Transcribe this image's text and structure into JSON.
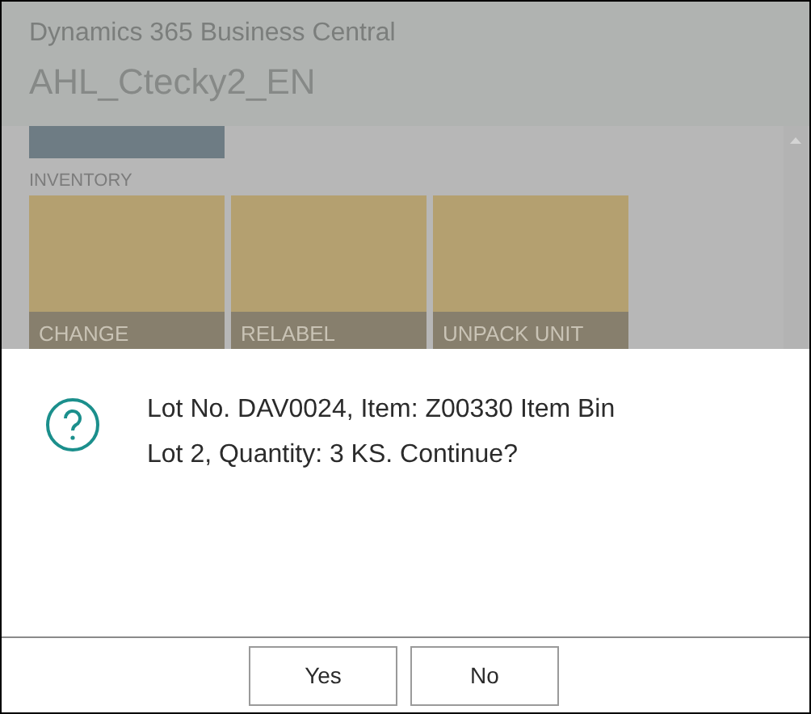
{
  "header": {
    "app_title": "Dynamics 365 Business Central",
    "company": "AHL_Ctecky2_EN"
  },
  "top_tile": {
    "color": "#6e7c84"
  },
  "section": {
    "title": "INVENTORY",
    "tiles": [
      {
        "label": "CHANGE",
        "color": "#b4a070"
      },
      {
        "label": "RELABEL",
        "color": "#b4a070"
      },
      {
        "label": "UNPACK UNIT",
        "color": "#b4a070"
      }
    ]
  },
  "dialog": {
    "message": "Lot No. DAV0024, Item: Z00330 Item Bin Lot 2, Quantity: 3 KS. Continue?",
    "buttons": [
      "Yes",
      "No"
    ]
  }
}
